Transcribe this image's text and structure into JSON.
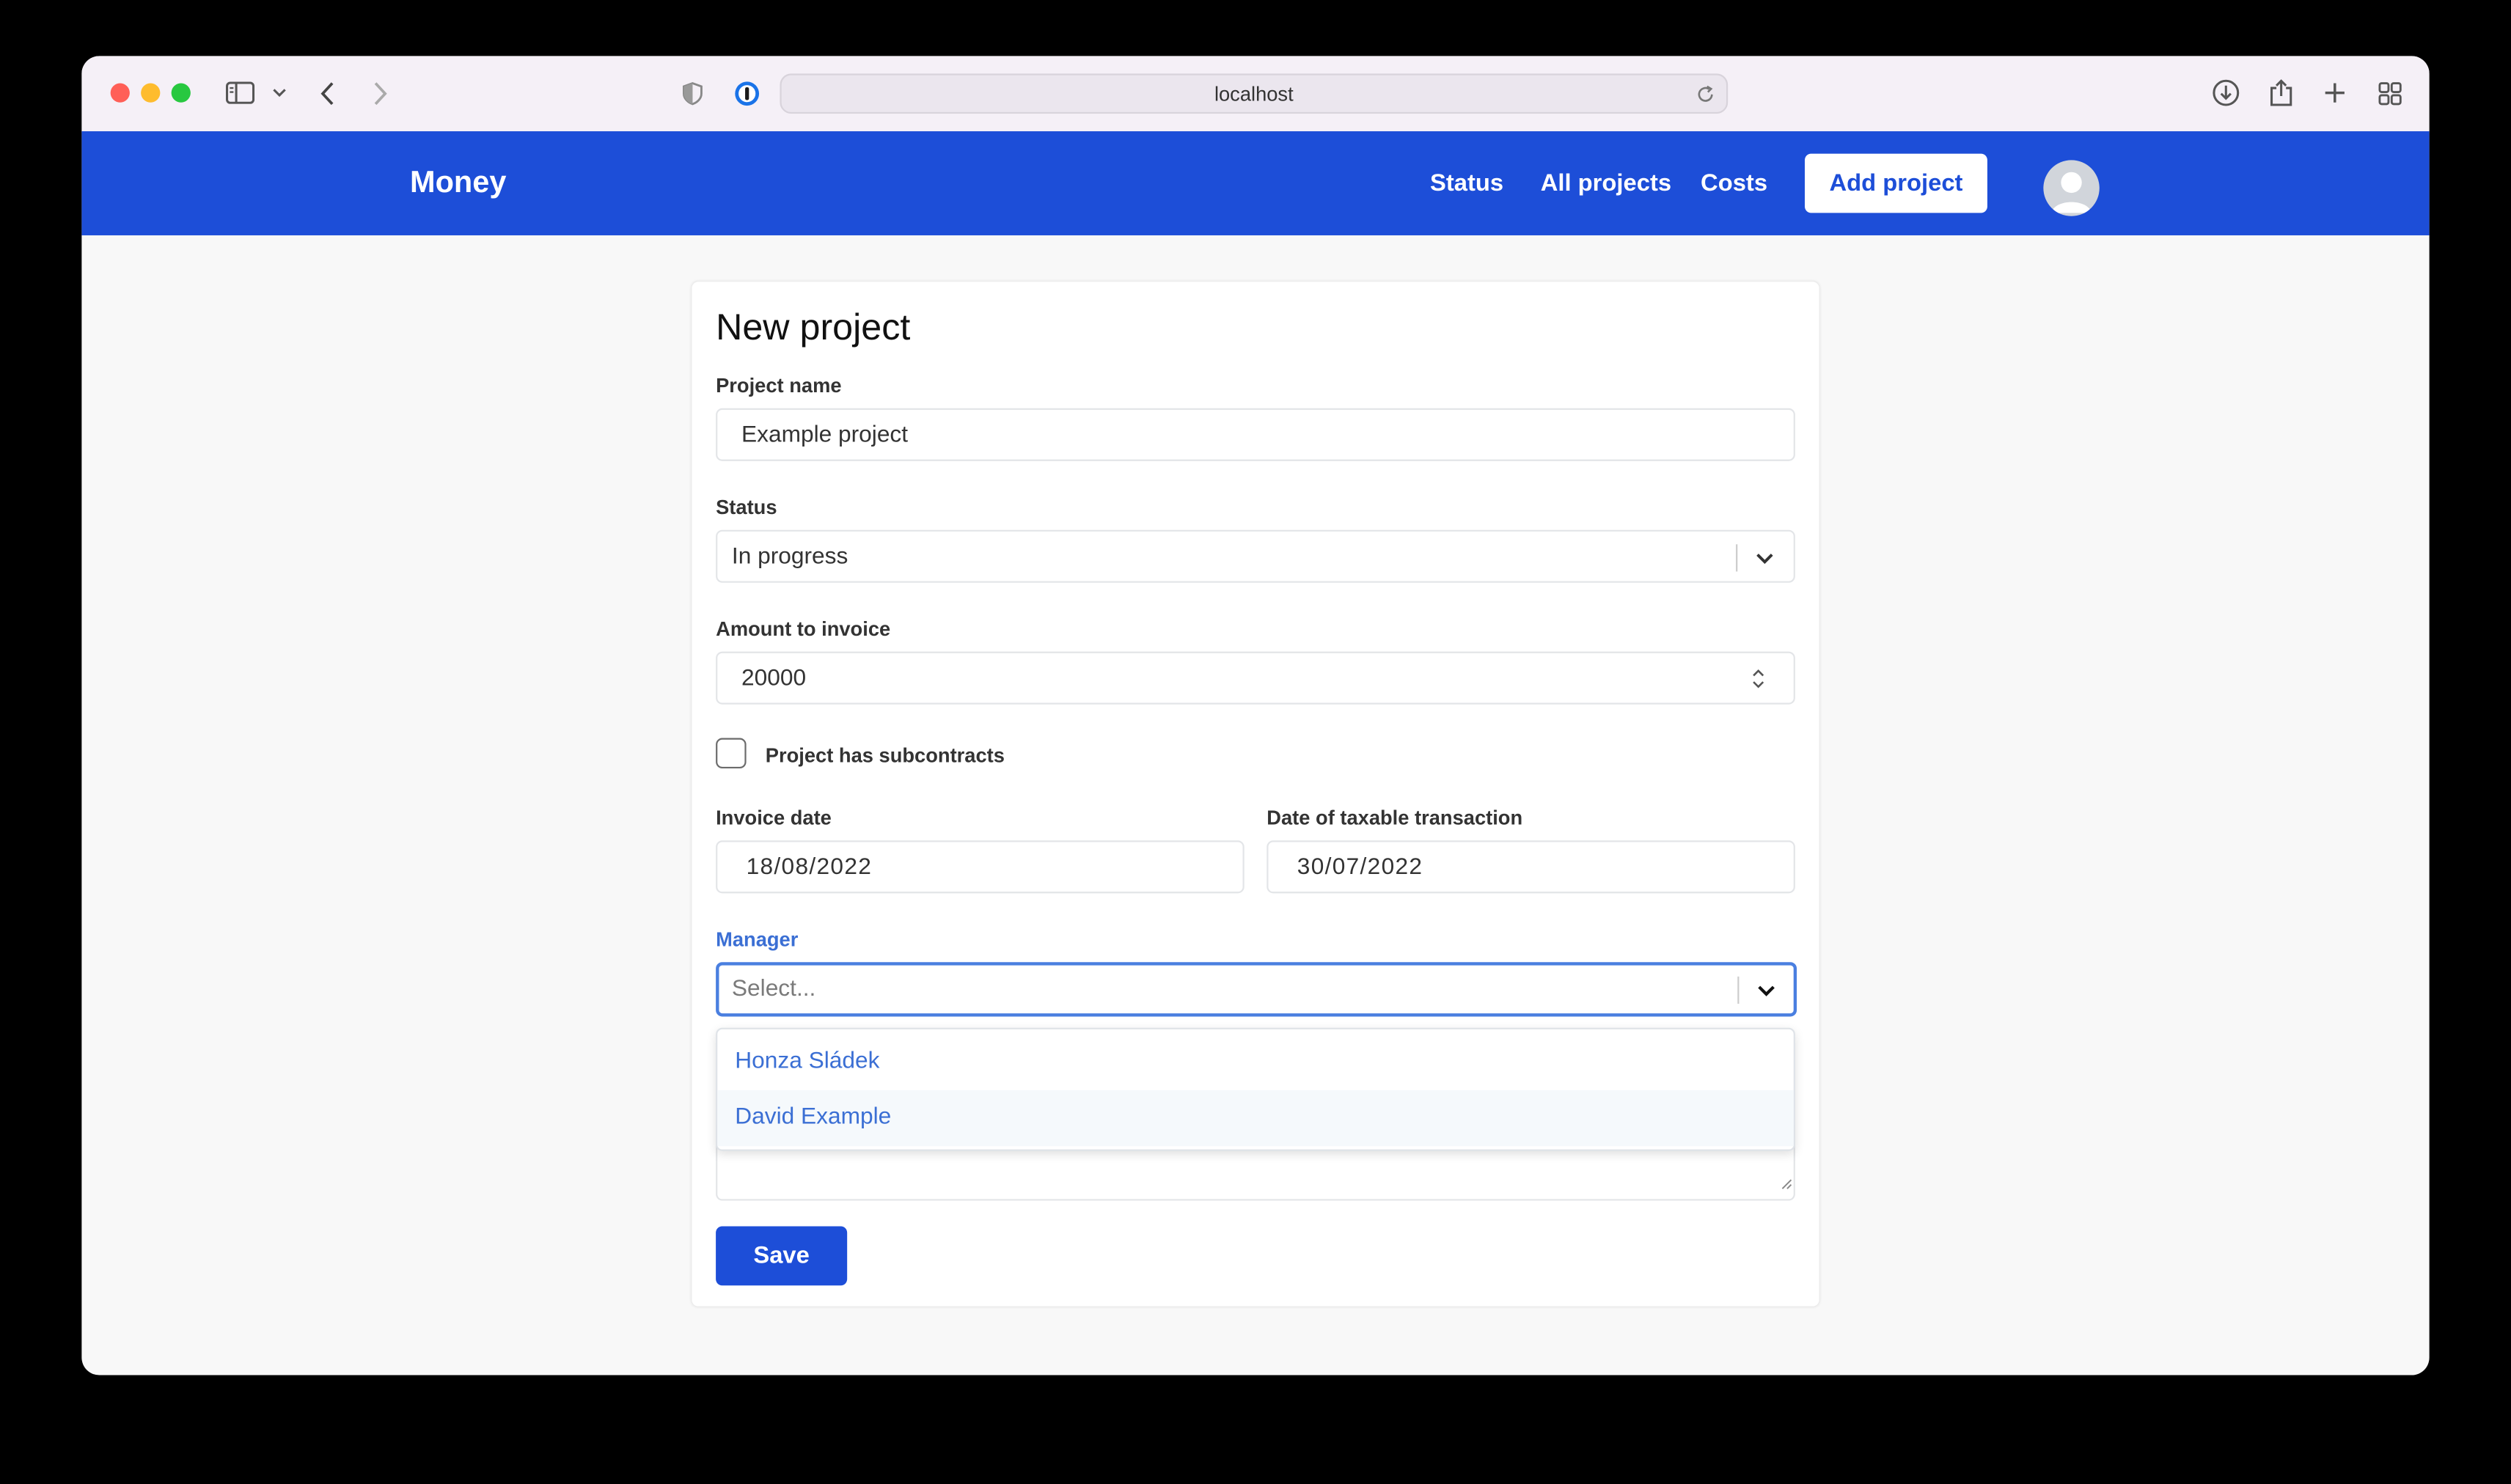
{
  "browser": {
    "url": "localhost",
    "traffic_lights": {
      "close": "#ff5f57",
      "minimize": "#febc2e",
      "zoom": "#28c840"
    }
  },
  "navbar": {
    "brand": "Money",
    "links": [
      "Status",
      "All projects",
      "Costs"
    ],
    "add_button": "Add project",
    "color": "#1d4ed8"
  },
  "form": {
    "title": "New project",
    "project_name": {
      "label": "Project name",
      "value": "Example project"
    },
    "status": {
      "label": "Status",
      "value": "In progress"
    },
    "amount": {
      "label": "Amount to invoice",
      "value": "20000"
    },
    "subcontracts": {
      "label": "Project has subcontracts",
      "checked": false
    },
    "invoice_date": {
      "label": "Invoice date",
      "value": "18/08/2022"
    },
    "taxable_date": {
      "label": "Date of taxable transaction",
      "value": "30/07/2022"
    },
    "manager": {
      "label": "Manager",
      "placeholder": "Select...",
      "options": [
        "Honza Sládek",
        "David Example"
      ]
    },
    "save_button": "Save"
  }
}
